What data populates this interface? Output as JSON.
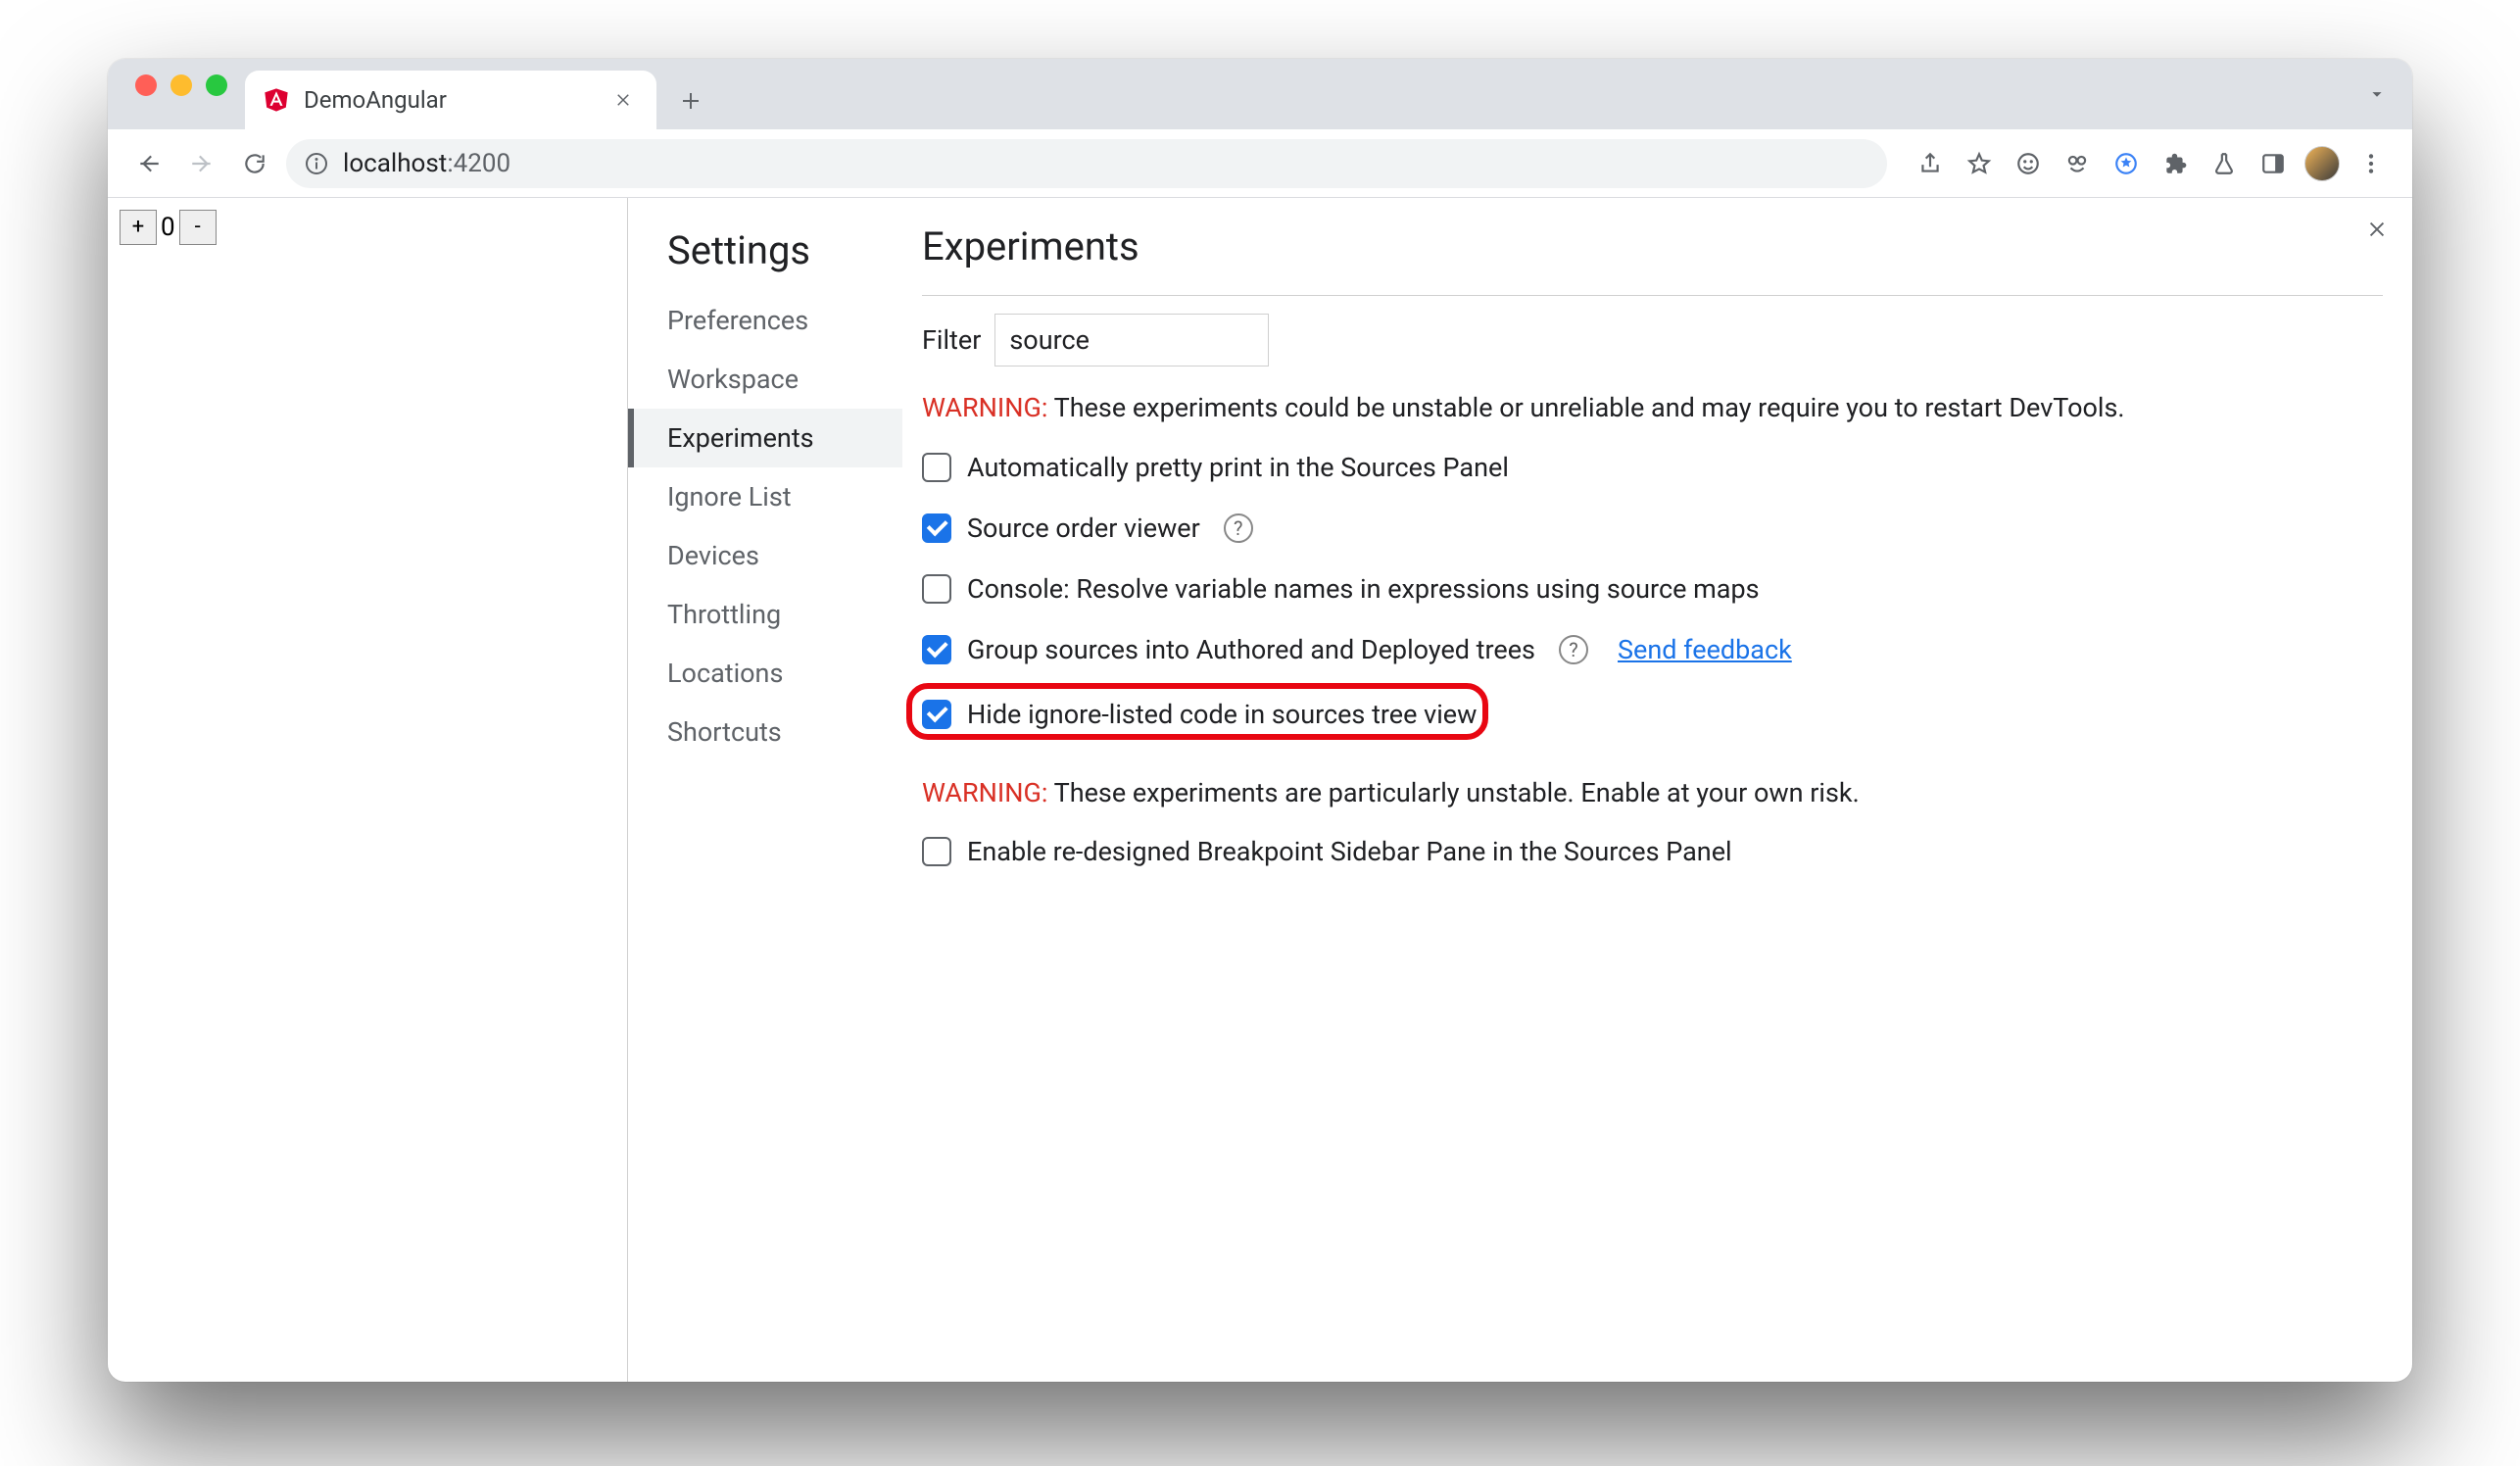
{
  "browser": {
    "tab_title": "DemoAngular",
    "url_host": "localhost",
    "url_path": ":4200"
  },
  "page": {
    "counter_value": "0",
    "plus_label": "+",
    "minus_label": "-"
  },
  "settings": {
    "title": "Settings",
    "nav": [
      {
        "label": "Preferences"
      },
      {
        "label": "Workspace"
      },
      {
        "label": "Experiments"
      },
      {
        "label": "Ignore List"
      },
      {
        "label": "Devices"
      },
      {
        "label": "Throttling"
      },
      {
        "label": "Locations"
      },
      {
        "label": "Shortcuts"
      }
    ],
    "active_nav_index": 2
  },
  "experiments": {
    "title": "Experiments",
    "filter_label": "Filter",
    "filter_value": "source",
    "warning1_prefix": "WARNING:",
    "warning1_text": " These experiments could be unstable or unreliable and may require you to restart DevTools.",
    "items": [
      {
        "label": "Automatically pretty print in the Sources Panel",
        "checked": false,
        "help": false
      },
      {
        "label": "Source order viewer",
        "checked": true,
        "help": true
      },
      {
        "label": "Console: Resolve variable names in expressions using source maps",
        "checked": false,
        "help": false
      },
      {
        "label": "Group sources into Authored and Deployed trees",
        "checked": true,
        "help": true,
        "feedback": "Send feedback"
      },
      {
        "label": "Hide ignore-listed code in sources tree view",
        "checked": true,
        "help": false,
        "highlight": true
      }
    ],
    "warning2_prefix": "WARNING:",
    "warning2_text": " These experiments are particularly unstable. Enable at your own risk.",
    "unstable_items": [
      {
        "label": "Enable re-designed Breakpoint Sidebar Pane in the Sources Panel",
        "checked": false
      }
    ]
  }
}
